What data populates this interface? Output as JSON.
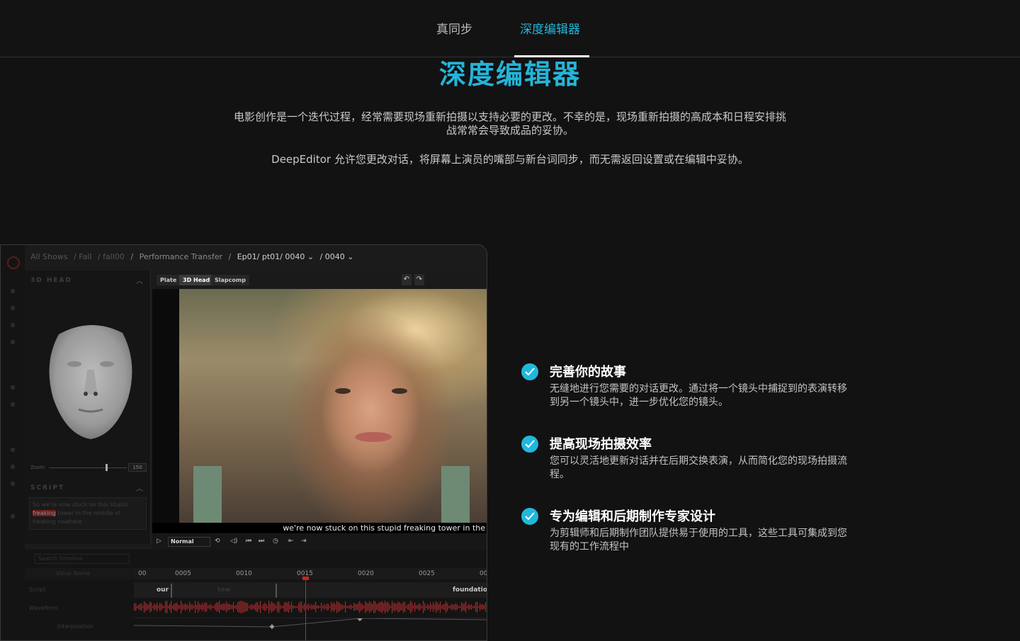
{
  "nav": {
    "tabs": [
      {
        "label": "真同步",
        "active": false
      },
      {
        "label": "深度编辑器",
        "active": true
      }
    ]
  },
  "hero": {
    "title": "深度编辑器",
    "paragraph1": "电影创作是一个迭代过程，经常需要现场重新拍摄以支持必要的更改。不幸的是，现场重新拍摄的高成本和日程安排挑战常常会导致成品的妥协。",
    "paragraph2": "DeepEditor 允许您更改对话，将屏幕上演员的嘴部与新台词同步，而无需返回设置或在编辑中妥协。"
  },
  "app": {
    "breadcrumbs": [
      "All Shows",
      "/ Fall",
      "/ fall00",
      "/",
      "Performance Transfer",
      "/",
      "Ep01/ pt01/ 0040 ⌄",
      "/ 0040 ⌄"
    ],
    "panel_3d_head": "3D HEAD",
    "panel_script": "SCRIPT",
    "zoom_label": "Zoom",
    "zoom_value": "150",
    "script_text_before": "So we're now stuck on this stupid",
    "script_highlight": "freaking",
    "script_text_after": "tower in the middle of freaking nowhere",
    "viewer_tabs": [
      "Plate",
      "3D Head",
      "Slapcomp"
    ],
    "subtitle": "we're now stuck on this stupid freaking tower in the",
    "playback_mode": "Normal",
    "timeline_search_placeholder": "Search timeline",
    "timeline_value_name": "Value Name",
    "timeline_ticks": [
      "00",
      "0005",
      "0010",
      "0015",
      "0020",
      "0025",
      "00"
    ],
    "row_labels": [
      "Script",
      "Waveform",
      "Interpolation"
    ],
    "script_words": [
      "our",
      "tow",
      "foundation"
    ]
  },
  "features": [
    {
      "title": "完善你的故事",
      "description": "无缝地进行您需要的对话更改。通过将一个镜头中捕捉到的表演转移到另一个镜头中，进一步优化您的镜头。"
    },
    {
      "title": "提高现场拍摄效率",
      "description": "您可以灵活地更新对话并在后期交换表演，从而简化您的现场拍摄流程。"
    },
    {
      "title": "专为编辑和后期制作专家设计",
      "description": "为剪辑师和后期制作团队提供易于使用的工具，这些工具可集成到您现有的工作流程中"
    }
  ],
  "colors": {
    "accent": "#25b4d8",
    "background": "#121212",
    "playhead": "#cc2222"
  }
}
